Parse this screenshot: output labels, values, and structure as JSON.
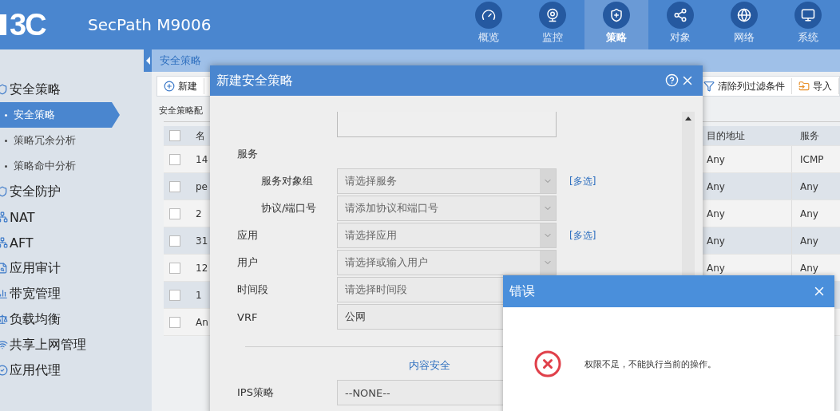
{
  "header": {
    "logo": "3C",
    "product": "SecPath M9006",
    "nav": [
      {
        "label": "概览",
        "selected": false
      },
      {
        "label": "监控",
        "selected": false
      },
      {
        "label": "策略",
        "selected": true
      },
      {
        "label": "对象",
        "selected": false
      },
      {
        "label": "网络",
        "selected": false
      },
      {
        "label": "系统",
        "selected": false
      }
    ]
  },
  "breadcrumb": "安全策略",
  "sidebar": {
    "items": [
      {
        "label": "安全策略",
        "children": [
          {
            "label": "安全策略",
            "selected": true
          },
          {
            "label": "策略冗余分析",
            "selected": false
          },
          {
            "label": "策略命中分析",
            "selected": false
          }
        ]
      },
      {
        "label": "安全防护"
      },
      {
        "label": "NAT"
      },
      {
        "label": "AFT"
      },
      {
        "label": "应用审计"
      },
      {
        "label": "带宽管理"
      },
      {
        "label": "负载均衡"
      },
      {
        "label": "共享上网管理"
      },
      {
        "label": "应用代理"
      }
    ]
  },
  "toolbar": {
    "left": [
      {
        "label": "新建"
      }
    ],
    "right": [
      {
        "label": "清除列过滤条件"
      },
      {
        "label": "导入"
      }
    ]
  },
  "table": {
    "caption": "安全策略配",
    "columns": [
      "名",
      "目的地址",
      "服务"
    ],
    "checked": false,
    "rows": [
      {
        "name": "14",
        "dest": "Any",
        "service": "ICMP",
        "checked": false
      },
      {
        "name": "pe",
        "dest": "Any",
        "service": "Any",
        "checked": false
      },
      {
        "name": "2",
        "dest": "Any",
        "service": "Any",
        "checked": false
      },
      {
        "name": "31",
        "dest": "Any",
        "service": "Any",
        "checked": false
      },
      {
        "name": "12",
        "dest": "Any",
        "service": "Any",
        "checked": false
      },
      {
        "name": "1",
        "checked": false
      },
      {
        "name": "An",
        "checked": false
      }
    ]
  },
  "dialog": {
    "title": "新建安全策略",
    "form": [
      {
        "kind": "textarea"
      },
      {
        "kind": "group",
        "label": "服务",
        "children": [
          {
            "kind": "select",
            "label": "服务对象组",
            "placeholder": "请选择服务",
            "link": "[多选]"
          },
          {
            "kind": "select",
            "label": "协议/端口号",
            "placeholder": "请添加协议和端口号"
          }
        ]
      },
      {
        "kind": "select",
        "label": "应用",
        "placeholder": "请选择应用",
        "link": "[多选]"
      },
      {
        "kind": "select",
        "label": "用户",
        "placeholder": "请选择或输入用户"
      },
      {
        "kind": "select",
        "label": "时间段",
        "placeholder": "请选择时间段"
      },
      {
        "kind": "select",
        "label": "VRF",
        "value": "公网"
      },
      {
        "kind": "divider"
      },
      {
        "kind": "heading",
        "label": "内容安全"
      },
      {
        "kind": "select",
        "label": "IPS策略",
        "value": "--NONE--"
      }
    ]
  },
  "error": {
    "title": "错误",
    "message": "权限不足，不能执行当前的操作。"
  }
}
